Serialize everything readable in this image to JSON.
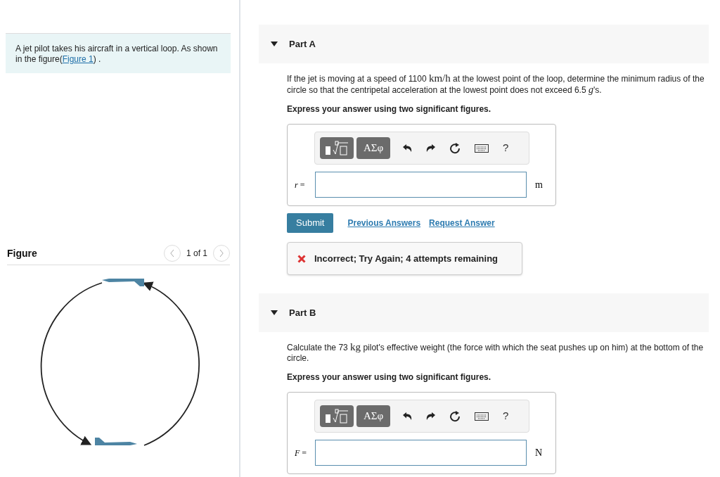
{
  "intro": [
    {
      "kind": "text",
      "text": "A jet pilot takes his aircraft in a vertical loop. As shown in the figure("
    },
    {
      "kind": "link",
      "text": "Figure 1"
    },
    {
      "kind": "text",
      "text": ") ."
    }
  ],
  "figure": {
    "title": "Figure",
    "pager": "1 of 1"
  },
  "parts": [
    {
      "title": "Part A",
      "expanded": true,
      "prompt": [
        {
          "kind": "text",
          "text": "If the jet is moving at a speed of 1100 "
        },
        {
          "kind": "unit",
          "text": "km/h"
        },
        {
          "kind": "text",
          "text": " at the lowest point of the loop, determine the minimum radius of the circle so that the centripetal acceleration at the lowest point does not exceed 6.5 "
        },
        {
          "kind": "var",
          "text": "g"
        },
        {
          "kind": "text",
          "text": "'s."
        }
      ],
      "instruction": "Express your answer using two significant figures.",
      "toolbar": {
        "symbols": "ΑΣφ",
        "help": "?"
      },
      "label": "*r* =",
      "unit": "m",
      "actions": {
        "submit": "Submit",
        "links": [
          "Previous Answers",
          "Request Answer"
        ]
      },
      "feedback": {
        "kind": "incorrect",
        "text": "Incorrect; Try Again; 4 attempts remaining"
      }
    },
    {
      "title": "Part B",
      "expanded": true,
      "prompt": [
        {
          "kind": "text",
          "text": "Calculate the 73 "
        },
        {
          "kind": "unit",
          "text": "kg"
        },
        {
          "kind": "text",
          "text": " pilot's effective weight (the force with which the seat pushes up on him) at the bottom of the circle."
        }
      ],
      "instruction": "Express your answer using two significant figures.",
      "toolbar": {
        "symbols": "ΑΣφ",
        "help": "?"
      },
      "label": "*F* =",
      "unit": "N"
    }
  ]
}
